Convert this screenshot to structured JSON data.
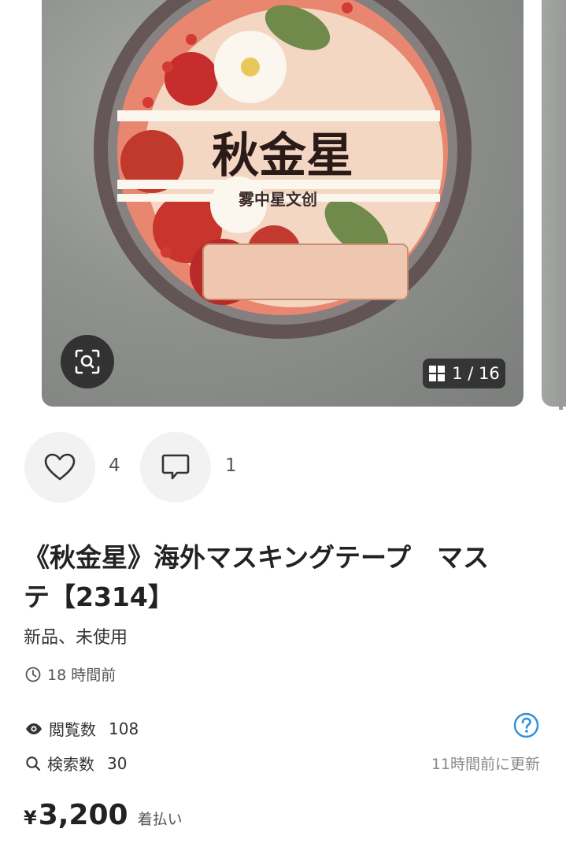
{
  "gallery": {
    "image_label": "秋金星",
    "image_sublabel": "雾中星文创",
    "counter": "1 / 16",
    "current": 1,
    "total": 16
  },
  "reactions": {
    "likes": "4",
    "comments": "1"
  },
  "item": {
    "title_line1": "《秋金星》海外マスキングテープ　マス",
    "title_line2": "テ【2314】",
    "condition": "新品、未使用",
    "posted": "18 時間前"
  },
  "stats": {
    "views_label": "閲覧数",
    "views": "108",
    "search_label": "検索数",
    "search": "30",
    "updated": "11時間前に更新"
  },
  "price": {
    "currency": "¥",
    "amount": "3,200",
    "shipping": "着払い"
  },
  "colors": {
    "help_blue": "#2f8fdb",
    "accent_red": "#c83a2c"
  }
}
